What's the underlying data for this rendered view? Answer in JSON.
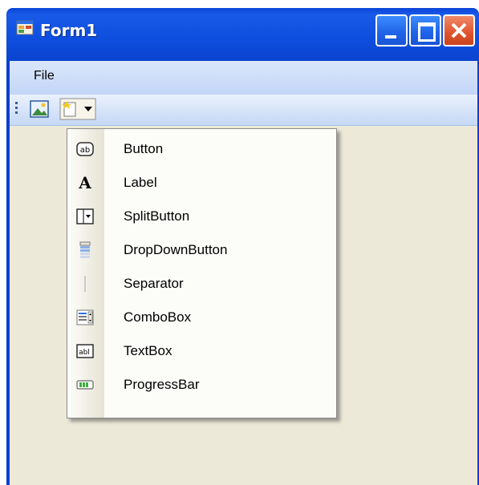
{
  "window": {
    "title": "Form1",
    "icon": "form-window-icon",
    "buttons": [
      "minimize-icon",
      "maximize-icon",
      "close-icon"
    ]
  },
  "menubar": {
    "items": [
      "File"
    ]
  },
  "toolstrip": {
    "tools": [
      "image-tool-icon",
      "add-item-dropdown-icon"
    ]
  },
  "dropdown": {
    "items": [
      {
        "label": "Button",
        "icon": "button-icon"
      },
      {
        "label": "Label",
        "icon": "label-icon"
      },
      {
        "label": "SplitButton",
        "icon": "splitbutton-icon"
      },
      {
        "label": "DropDownButton",
        "icon": "dropdownbutton-icon"
      },
      {
        "label": "Separator",
        "icon": "separator-icon"
      },
      {
        "label": "ComboBox",
        "icon": "combobox-icon"
      },
      {
        "label": "TextBox",
        "icon": "textbox-icon"
      },
      {
        "label": "ProgressBar",
        "icon": "progressbar-icon"
      }
    ]
  },
  "colors": {
    "titlebar": "#0a44d8",
    "client": "#ece9d8",
    "menubar": "#c3d6f7"
  }
}
